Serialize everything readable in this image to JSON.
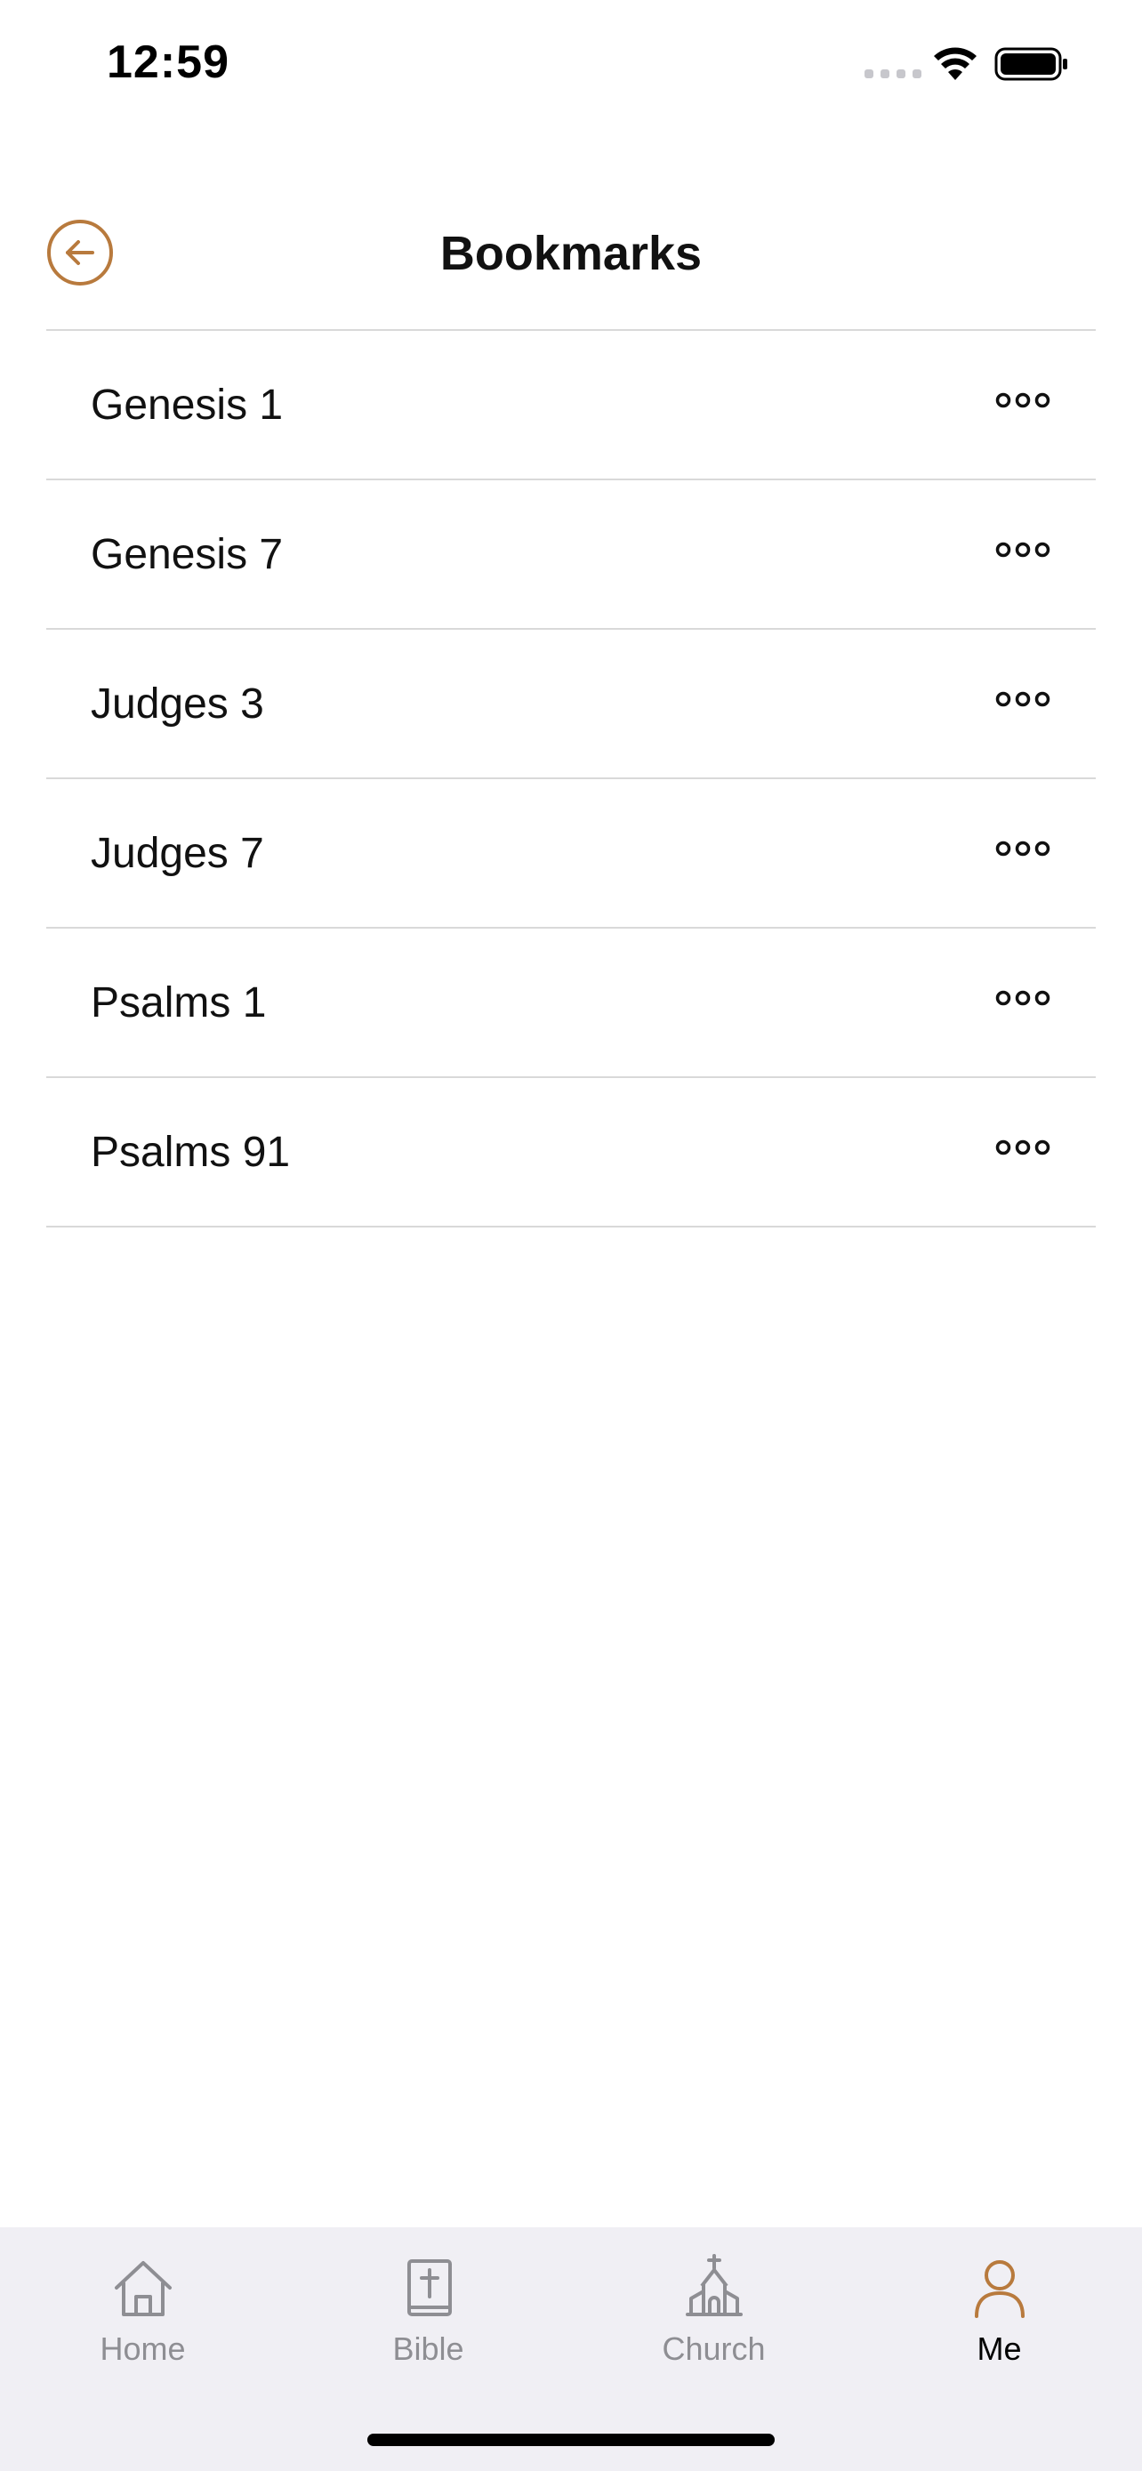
{
  "status_bar": {
    "time": "12:59"
  },
  "header": {
    "title": "Bookmarks",
    "back_icon": "arrow-left-circle-icon"
  },
  "bookmarks": [
    {
      "label": "Genesis 1"
    },
    {
      "label": "Genesis 7"
    },
    {
      "label": "Judges 3"
    },
    {
      "label": "Judges 7"
    },
    {
      "label": "Psalms 1"
    },
    {
      "label": "Psalms 91"
    }
  ],
  "tab_bar": {
    "tabs": [
      {
        "label": "Home",
        "icon": "house-icon",
        "active": false
      },
      {
        "label": "Bible",
        "icon": "bible-icon",
        "active": false
      },
      {
        "label": "Church",
        "icon": "church-icon",
        "active": false
      },
      {
        "label": "Me",
        "icon": "person-icon",
        "active": true
      }
    ]
  },
  "colors": {
    "accent": "#B87A3D",
    "inactive": "#8E8E93",
    "tab_bar_bg": "#F0EFF4",
    "divider": "#D9D9D9"
  }
}
